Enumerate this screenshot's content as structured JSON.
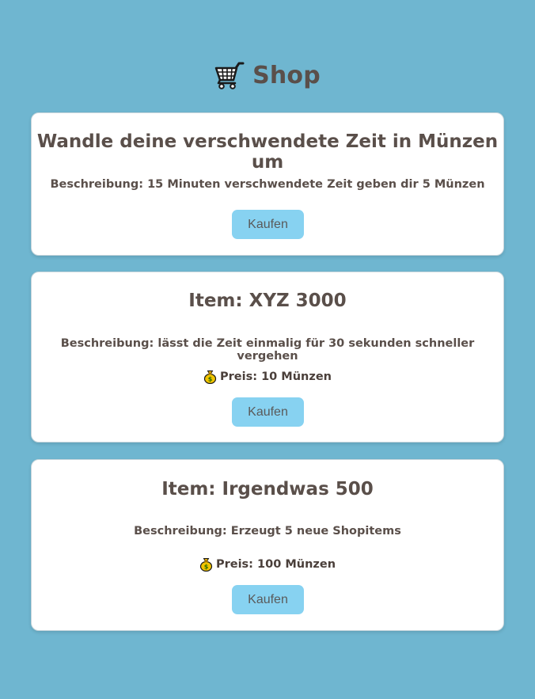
{
  "header": {
    "title": "Shop",
    "icon": "shopping-cart-icon"
  },
  "items": [
    {
      "title": "Wandle deine verschwendete Zeit in Münzen um",
      "description": "Beschreibung: 15 Minuten verschwendete Zeit geben dir 5 Münzen",
      "button_label": "Kaufen"
    },
    {
      "title": "Item: XYZ 3000",
      "description": "Beschreibung: lässt die Zeit einmalig für 30 sekunden schneller vergehen",
      "price": "Preis: 10 Münzen",
      "price_icon": "money-bag-icon",
      "button_label": "Kaufen"
    },
    {
      "title": "Item: Irgendwas 500",
      "description": "Beschreibung: Erzeugt 5 neue Shopitems",
      "price": "Preis: 100 Münzen",
      "price_icon": "money-bag-icon",
      "button_label": "Kaufen"
    }
  ],
  "colors": {
    "background": "#6fb6d0",
    "card": "#ffffff",
    "button": "#87d2f1",
    "text": "#5a4f4a"
  }
}
